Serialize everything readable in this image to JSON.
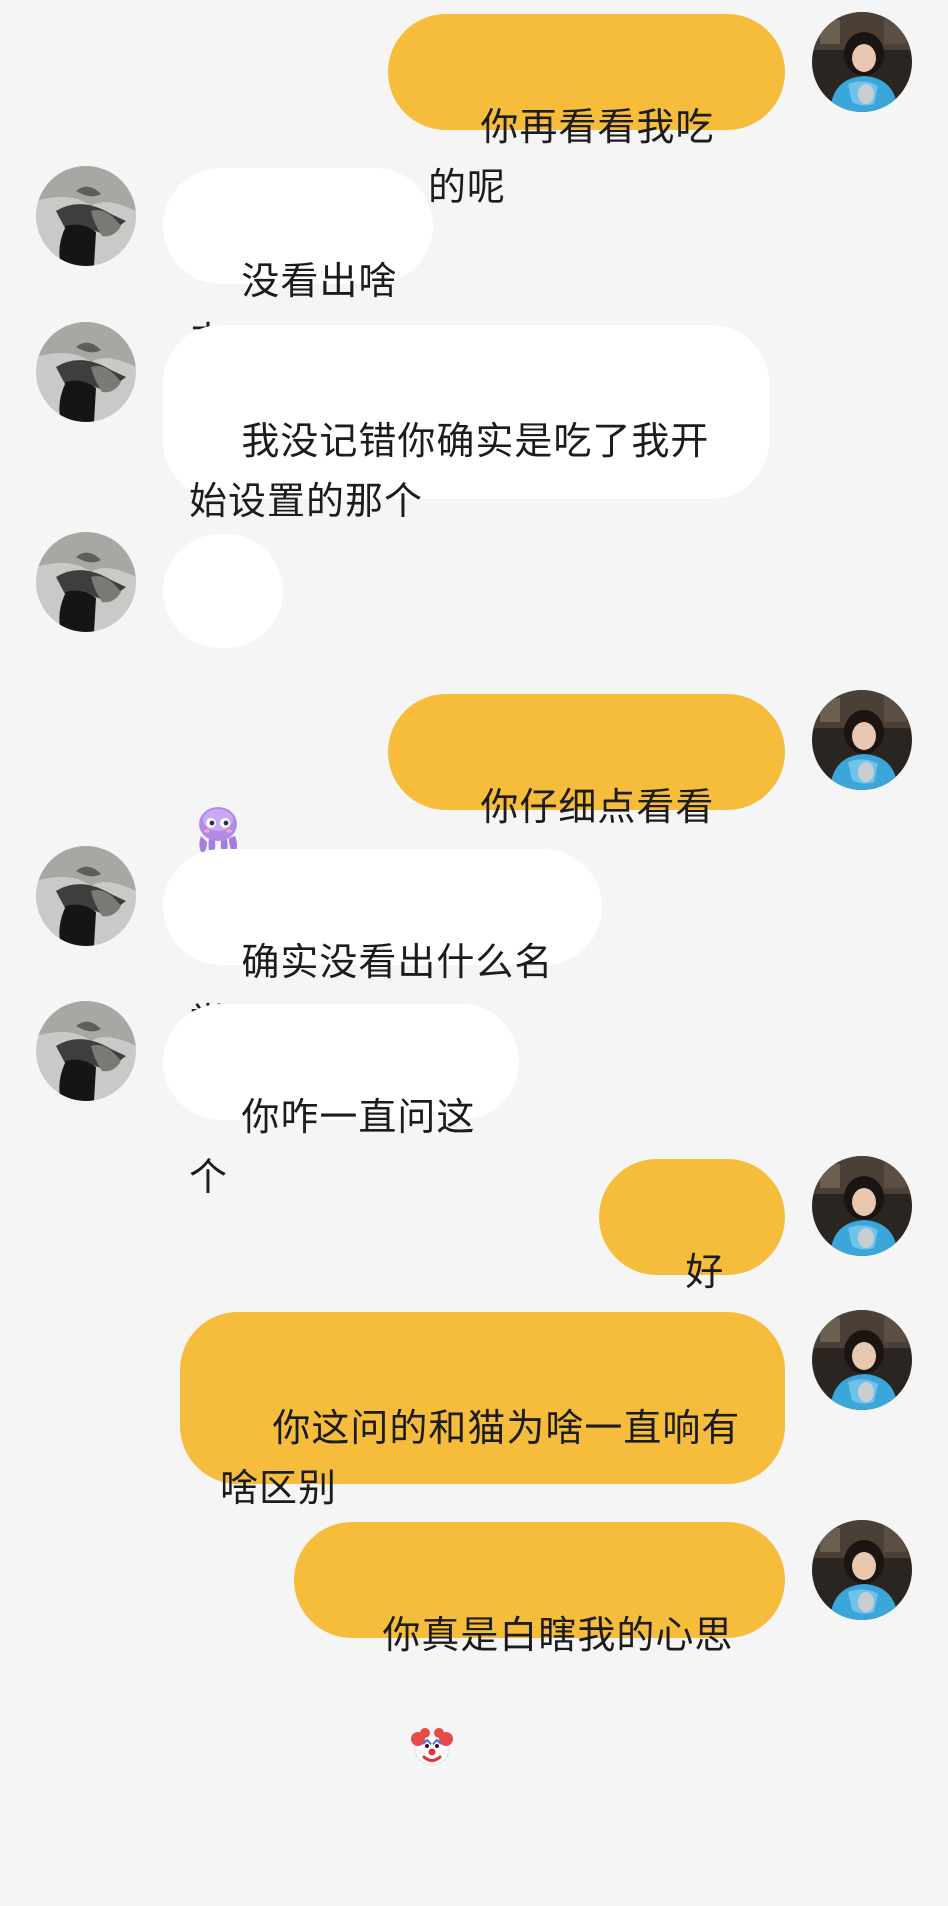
{
  "chat": {
    "messages": [
      {
        "sender": "me",
        "text": "你再看看我吃的呢"
      },
      {
        "sender": "them",
        "text": "没看出啥来"
      },
      {
        "sender": "them",
        "text": "我没记错你确实是吃了我开始设置的那个"
      },
      {
        "sender": "them",
        "sticker": "octopus-sticker"
      },
      {
        "sender": "me",
        "text": "你仔细点看看呢？"
      },
      {
        "sender": "them",
        "text": "确实没看出什么名堂"
      },
      {
        "sender": "them",
        "text": "你咋一直问这个"
      },
      {
        "sender": "me",
        "text": "好好好"
      },
      {
        "sender": "me",
        "text": "你这问的和猫为啥一直响有啥区别"
      },
      {
        "sender": "me",
        "text": "你真是白瞎我的心思",
        "trailing_emoji": "clown-face-emoji"
      }
    ]
  },
  "colors": {
    "background": "#f5f5f5",
    "my_bubble": "#f6bd3c",
    "their_bubble": "#ffffff",
    "text": "#1c1c1c"
  },
  "icons": {
    "my_avatar": "avatar-girl-blue-sweater",
    "their_avatar": "avatar-gray-photo"
  }
}
